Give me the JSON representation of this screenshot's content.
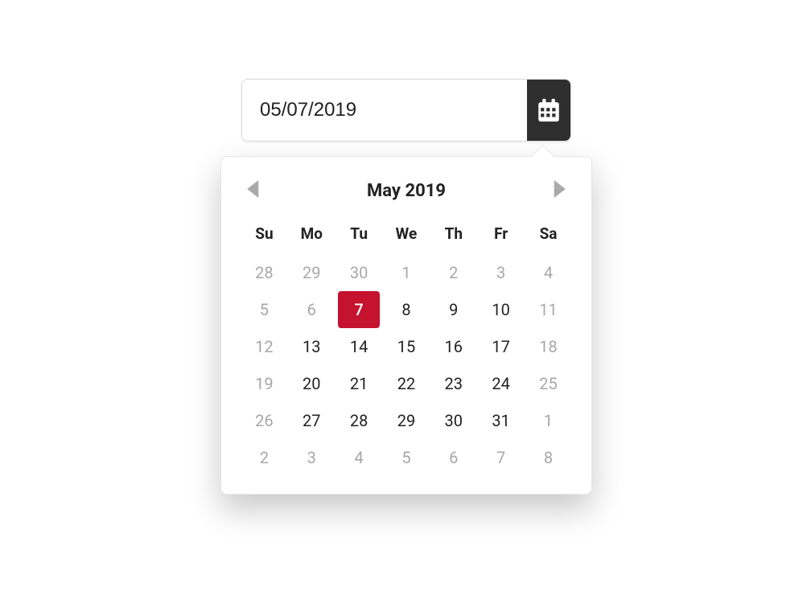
{
  "input": {
    "value": "05/07/2019"
  },
  "icons": {
    "calendar": "calendar-icon",
    "prev": "chevron-left-icon",
    "next": "chevron-right-icon"
  },
  "calendar": {
    "title": "May 2019",
    "weekdays": [
      "Su",
      "Mo",
      "Tu",
      "We",
      "Th",
      "Fr",
      "Sa"
    ],
    "selected_day": 7,
    "weeks": [
      [
        {
          "d": 28,
          "muted": true
        },
        {
          "d": 29,
          "muted": true
        },
        {
          "d": 30,
          "muted": true
        },
        {
          "d": 1,
          "muted": true
        },
        {
          "d": 2,
          "muted": true
        },
        {
          "d": 3,
          "muted": true
        },
        {
          "d": 4,
          "muted": true
        }
      ],
      [
        {
          "d": 5,
          "muted": true
        },
        {
          "d": 6,
          "muted": true
        },
        {
          "d": 7,
          "selected": true
        },
        {
          "d": 8
        },
        {
          "d": 9
        },
        {
          "d": 10
        },
        {
          "d": 11,
          "muted": true
        }
      ],
      [
        {
          "d": 12,
          "muted": true
        },
        {
          "d": 13
        },
        {
          "d": 14
        },
        {
          "d": 15
        },
        {
          "d": 16
        },
        {
          "d": 17
        },
        {
          "d": 18,
          "muted": true
        }
      ],
      [
        {
          "d": 19,
          "muted": true
        },
        {
          "d": 20
        },
        {
          "d": 21
        },
        {
          "d": 22
        },
        {
          "d": 23
        },
        {
          "d": 24
        },
        {
          "d": 25,
          "muted": true
        }
      ],
      [
        {
          "d": 26,
          "muted": true
        },
        {
          "d": 27
        },
        {
          "d": 28
        },
        {
          "d": 29
        },
        {
          "d": 30
        },
        {
          "d": 31
        },
        {
          "d": 1,
          "muted": true
        }
      ],
      [
        {
          "d": 2,
          "muted": true
        },
        {
          "d": 3,
          "muted": true
        },
        {
          "d": 4,
          "muted": true
        },
        {
          "d": 5,
          "muted": true
        },
        {
          "d": 6,
          "muted": true
        },
        {
          "d": 7,
          "muted": true
        },
        {
          "d": 8,
          "muted": true
        }
      ]
    ]
  },
  "colors": {
    "accent": "#c4122f",
    "button_bg": "#2f2f2f",
    "muted_text": "#a7a7a7"
  }
}
